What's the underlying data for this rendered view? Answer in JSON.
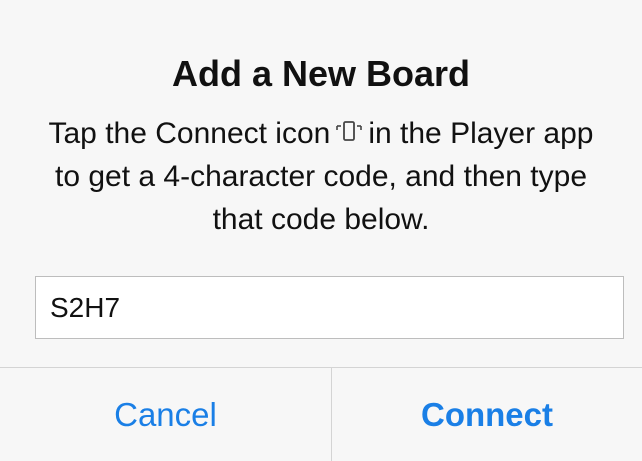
{
  "dialog": {
    "title": "Add a New Board",
    "message_before_icon": "Tap the Connect icon",
    "message_after_icon": "in the Player app to get a 4-character code, and then type that code below.",
    "icon": "phone-connect-icon",
    "code_value": "S2H7",
    "cancel_label": "Cancel",
    "connect_label": "Connect"
  },
  "colors": {
    "accent": "#1a7fe6",
    "background": "#f7f7f7",
    "text": "#111111",
    "divider": "#d4d4d4"
  }
}
